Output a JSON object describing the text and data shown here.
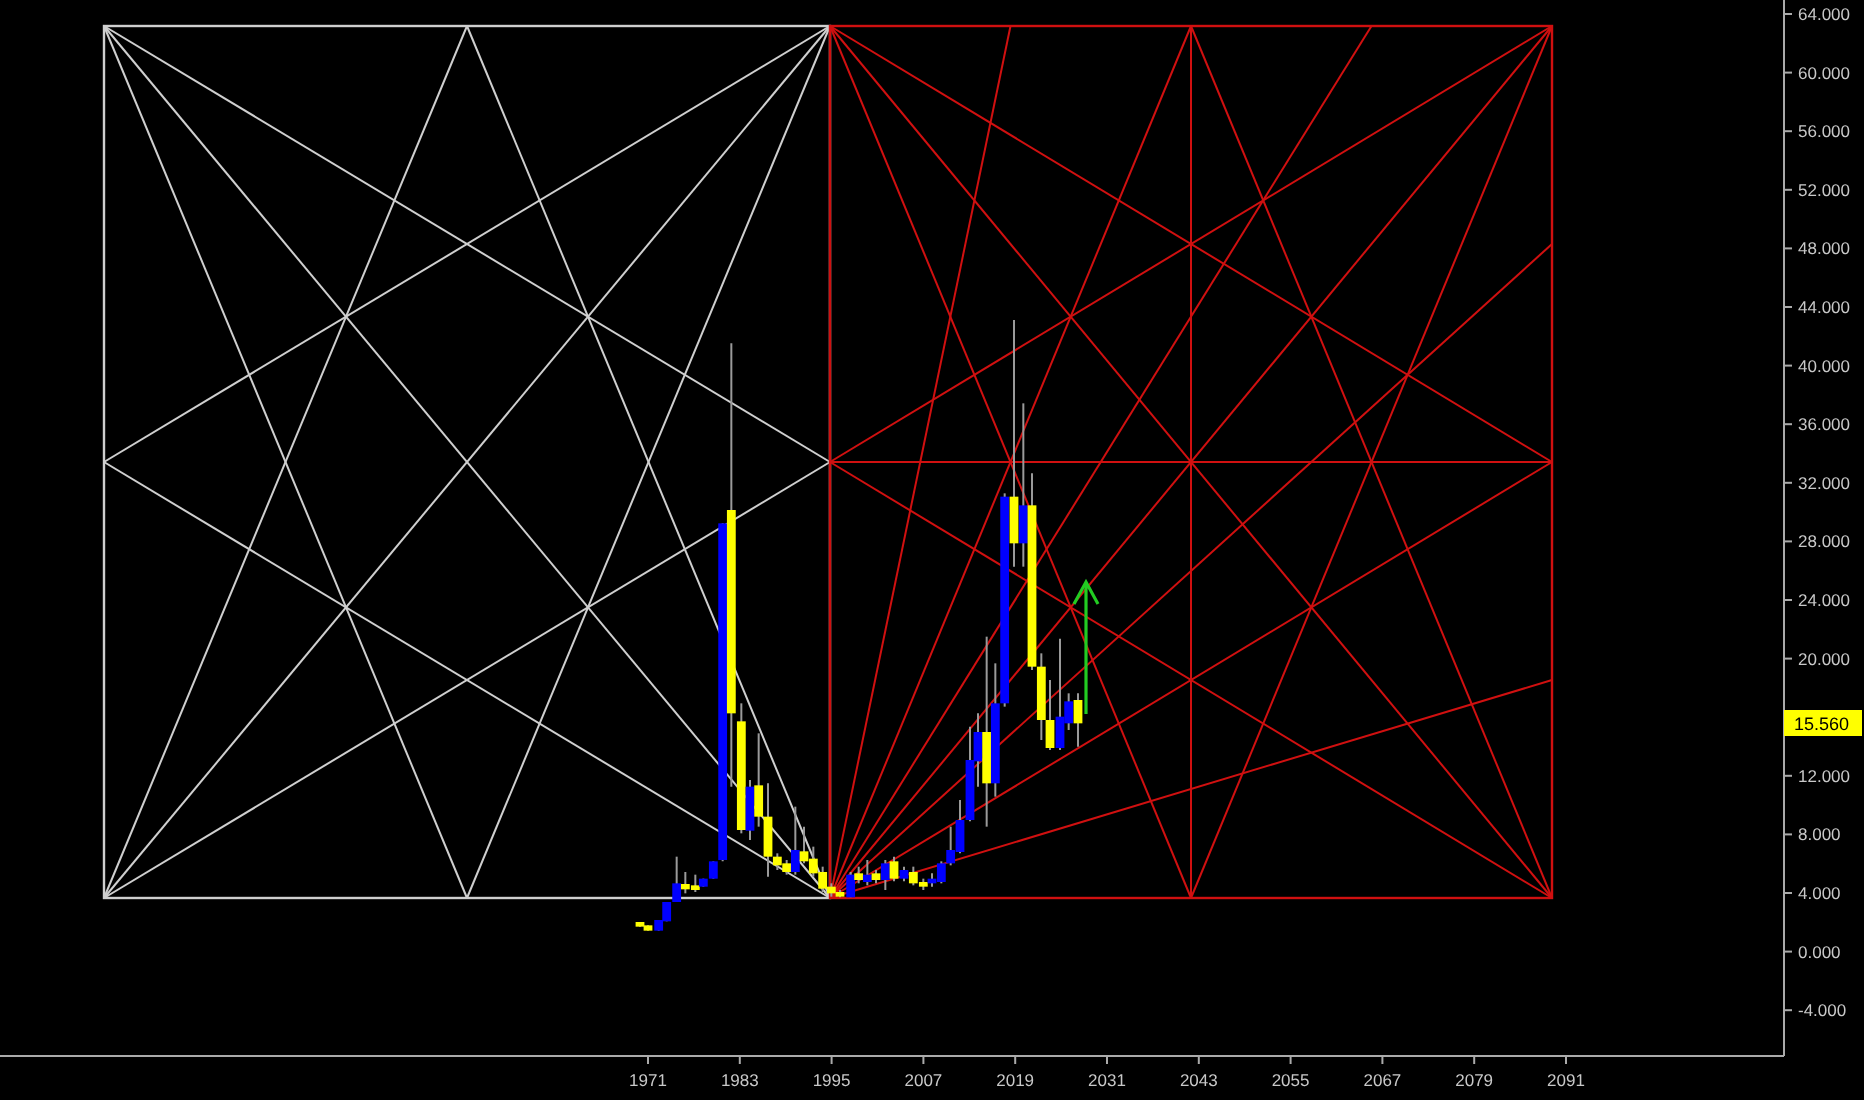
{
  "price_axis": {
    "ticks": [
      "64.000",
      "60.000",
      "56.000",
      "52.000",
      "48.000",
      "44.000",
      "40.000",
      "36.000",
      "32.000",
      "28.000",
      "24.000",
      "20.000",
      "12.000",
      "8.000",
      "4.000",
      "0.000",
      "-4.000"
    ]
  },
  "last_price": {
    "label": "15.560"
  },
  "time_axis": {
    "ticks": [
      "1971",
      "1983",
      "1995",
      "2007",
      "2019",
      "2031",
      "2043",
      "2055",
      "2067",
      "2079",
      "2091"
    ]
  }
}
